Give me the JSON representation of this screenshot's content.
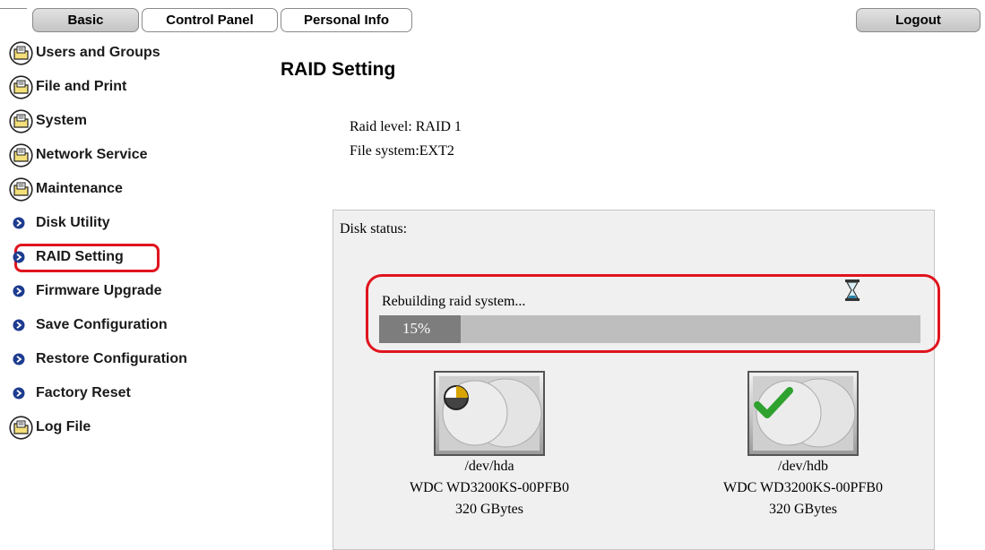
{
  "tabs": {
    "basic": "Basic",
    "control_panel": "Control Panel",
    "personal_info": "Personal Info",
    "logout": "Logout"
  },
  "sidebar": {
    "items": [
      {
        "label": "Users and Groups",
        "icon": "folder-icon"
      },
      {
        "label": "File and Print",
        "icon": "folder-icon"
      },
      {
        "label": "System",
        "icon": "folder-icon"
      },
      {
        "label": "Network Service",
        "icon": "folder-icon"
      },
      {
        "label": "Maintenance",
        "icon": "folder-icon"
      },
      {
        "label": "Disk Utility",
        "icon": "bullet-icon"
      },
      {
        "label": "RAID Setting",
        "icon": "bullet-icon",
        "selected": true
      },
      {
        "label": "Firmware Upgrade",
        "icon": "bullet-icon"
      },
      {
        "label": "Save Configuration",
        "icon": "bullet-icon"
      },
      {
        "label": "Restore Configuration",
        "icon": "bullet-icon"
      },
      {
        "label": "Factory Reset",
        "icon": "bullet-icon"
      },
      {
        "label": "Log File",
        "icon": "folder-icon"
      }
    ]
  },
  "main": {
    "title": "RAID Setting",
    "raid_level": "Raid level:  RAID 1",
    "file_system": "File system:EXT2",
    "disk_status_label": "Disk status:",
    "rebuild_text": "Rebuilding raid system...",
    "progress_label": "15%",
    "progress_fraction": 0.15,
    "disks": [
      {
        "device": "/dev/hda",
        "model": "WDC WD3200KS-00PFB0",
        "size": "320 GBytes",
        "status_icon": "rebuilding-icon"
      },
      {
        "device": "/dev/hdb",
        "model": "WDC WD3200KS-00PFB0",
        "size": "320 GBytes",
        "status_icon": "checkmark-icon"
      }
    ]
  },
  "colors": {
    "highlight": "#e0141e",
    "progress_track": "#bebebe",
    "progress_fill": "#7d7d7d",
    "check_green": "#2fa12f"
  }
}
